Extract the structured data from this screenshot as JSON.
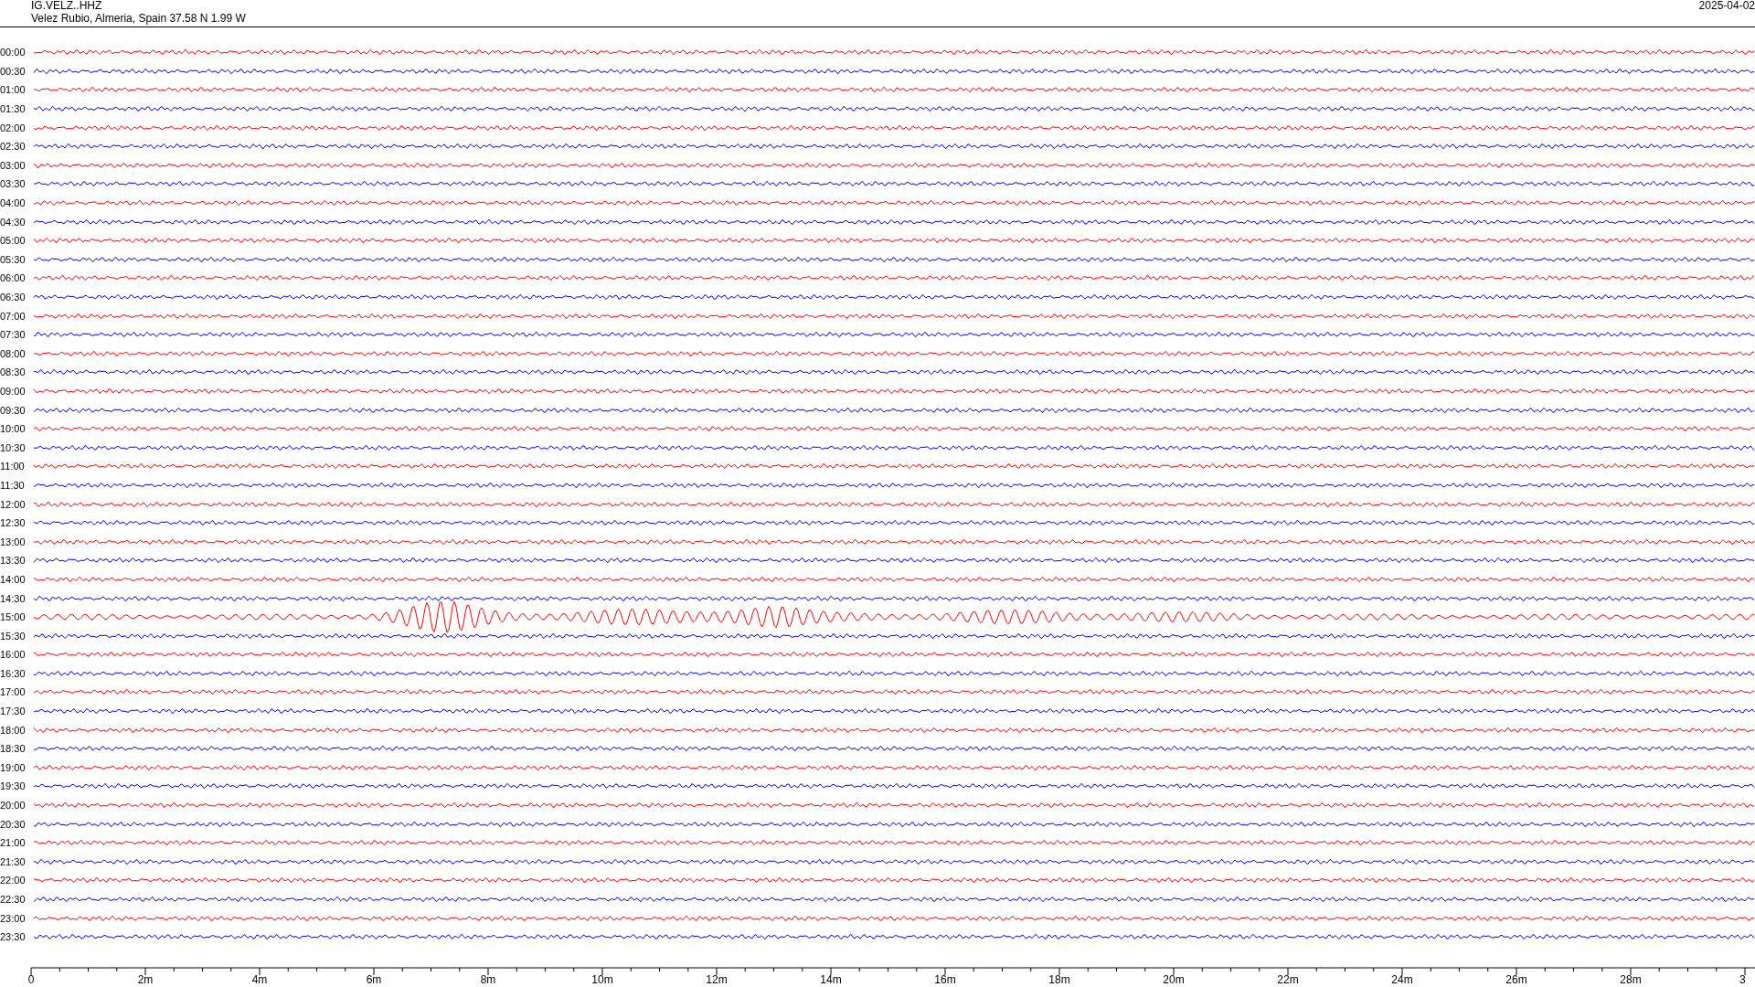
{
  "header": {
    "station": "IG.VELZ..HHZ",
    "location": "Velez Rubio, Almeria, Spain  37.58 N 1.99 W",
    "date": "2025-04-02"
  },
  "traces": [
    {
      "time": "00:00",
      "color": "#ff0000",
      "kind": "noise"
    },
    {
      "time": "00:30",
      "color": "#0000ff",
      "kind": "noise"
    },
    {
      "time": "01:00",
      "color": "#ff0000",
      "kind": "noise"
    },
    {
      "time": "01:30",
      "color": "#0000ff",
      "kind": "noise"
    },
    {
      "time": "02:00",
      "color": "#ff0000",
      "kind": "noise"
    },
    {
      "time": "02:30",
      "color": "#0000ff",
      "kind": "noise"
    },
    {
      "time": "03:00",
      "color": "#ff0000",
      "kind": "noise"
    },
    {
      "time": "03:30",
      "color": "#0000ff",
      "kind": "noise"
    },
    {
      "time": "04:00",
      "color": "#ff0000",
      "kind": "noise"
    },
    {
      "time": "04:30",
      "color": "#0000ff",
      "kind": "noise"
    },
    {
      "time": "05:00",
      "color": "#ff0000",
      "kind": "noise"
    },
    {
      "time": "05:30",
      "color": "#0000ff",
      "kind": "noise"
    },
    {
      "time": "06:00",
      "color": "#ff0000",
      "kind": "noise"
    },
    {
      "time": "06:30",
      "color": "#0000ff",
      "kind": "noise"
    },
    {
      "time": "07:00",
      "color": "#ff0000",
      "kind": "noise"
    },
    {
      "time": "07:30",
      "color": "#0000ff",
      "kind": "noise"
    },
    {
      "time": "08:00",
      "color": "#ff0000",
      "kind": "noise"
    },
    {
      "time": "08:30",
      "color": "#0000ff",
      "kind": "noise"
    },
    {
      "time": "09:00",
      "color": "#ff0000",
      "kind": "noise"
    },
    {
      "time": "09:30",
      "color": "#0000ff",
      "kind": "noise"
    },
    {
      "time": "10:00",
      "color": "#ff0000",
      "kind": "noise"
    },
    {
      "time": "10:30",
      "color": "#0000ff",
      "kind": "noise"
    },
    {
      "time": "11:00",
      "color": "#ff0000",
      "kind": "noise"
    },
    {
      "time": "11:30",
      "color": "#0000ff",
      "kind": "noise"
    },
    {
      "time": "12:00",
      "color": "#ff0000",
      "kind": "noise"
    },
    {
      "time": "12:30",
      "color": "#0000ff",
      "kind": "noise"
    },
    {
      "time": "13:00",
      "color": "#ff0000",
      "kind": "noise"
    },
    {
      "time": "13:30",
      "color": "#0000ff",
      "kind": "noise"
    },
    {
      "time": "14:00",
      "color": "#ff0000",
      "kind": "noise"
    },
    {
      "time": "14:30",
      "color": "#0000ff",
      "kind": "noise"
    },
    {
      "time": "15:00",
      "color": "#ff0000",
      "kind": "event"
    },
    {
      "time": "15:30",
      "color": "#0000ff",
      "kind": "noise"
    },
    {
      "time": "16:00",
      "color": "#ff0000",
      "kind": "noise"
    },
    {
      "time": "16:30",
      "color": "#0000ff",
      "kind": "noise"
    },
    {
      "time": "17:00",
      "color": "#ff0000",
      "kind": "noise"
    },
    {
      "time": "17:30",
      "color": "#0000ff",
      "kind": "noise"
    },
    {
      "time": "18:00",
      "color": "#ff0000",
      "kind": "noise"
    },
    {
      "time": "18:30",
      "color": "#0000ff",
      "kind": "noise"
    },
    {
      "time": "19:00",
      "color": "#ff0000",
      "kind": "noise"
    },
    {
      "time": "19:30",
      "color": "#0000ff",
      "kind": "noise"
    },
    {
      "time": "20:00",
      "color": "#ff0000",
      "kind": "noise"
    },
    {
      "time": "20:30",
      "color": "#0000ff",
      "kind": "noise"
    },
    {
      "time": "21:00",
      "color": "#ff0000",
      "kind": "noise"
    },
    {
      "time": "21:30",
      "color": "#0000ff",
      "kind": "noise"
    },
    {
      "time": "22:00",
      "color": "#ff0000",
      "kind": "noise"
    },
    {
      "time": "22:30",
      "color": "#0000ff",
      "kind": "noise"
    },
    {
      "time": "23:00",
      "color": "#ff0000",
      "kind": "noise"
    },
    {
      "time": "23:30",
      "color": "#0000ff",
      "kind": "noise"
    }
  ],
  "x_axis": {
    "ticks": [
      "0",
      "2m",
      "4m",
      "6m",
      "8m",
      "10m",
      "12m",
      "14m",
      "16m",
      "18m",
      "20m",
      "22m",
      "24m",
      "26m",
      "28m",
      "3"
    ]
  }
}
